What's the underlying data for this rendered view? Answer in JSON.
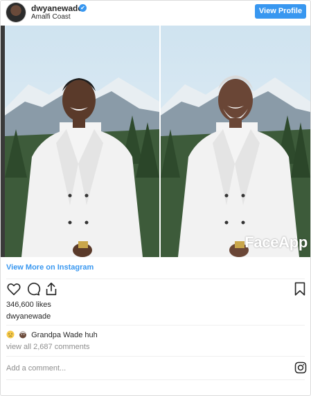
{
  "header": {
    "username": "dwyanewade",
    "verified_glyph": "✔",
    "location": "Amalfi Coast",
    "view_profile_label": "View Profile"
  },
  "photo": {
    "watermark": "FaceApp",
    "left_panel": "original photo",
    "right_panel": "aged photo"
  },
  "links": {
    "view_more": "View More on Instagram"
  },
  "actions": {
    "icons": [
      "heart-icon",
      "comment-icon",
      "share-icon",
      "bookmark-icon"
    ]
  },
  "stats": {
    "likes": "346,600 likes",
    "caption_user": "dwyanewade"
  },
  "comments": {
    "first_comment_text": "Grandpa Wade huh",
    "first_comment_emojis": [
      "thinking-face",
      "older-man-face"
    ],
    "view_all": "view all 2,687 comments"
  },
  "footer": {
    "add_comment_placeholder": "Add a comment..."
  },
  "colors": {
    "accent": "#3897f0",
    "text": "#262626",
    "muted": "#8e8e8e",
    "border": "#dbdbdb"
  }
}
